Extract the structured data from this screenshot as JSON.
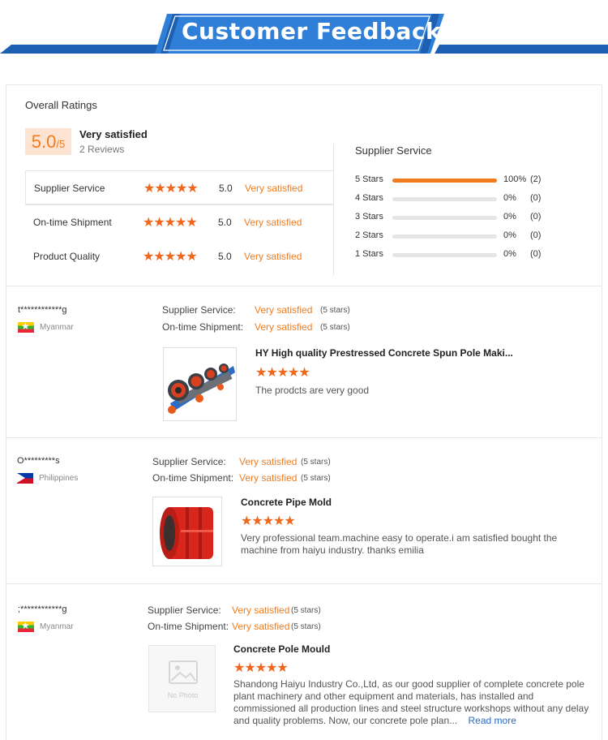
{
  "banner": {
    "title": "Customer Feedback",
    "color_dark": "#1d5fb0",
    "color_light": "#2f7ed8"
  },
  "overall": {
    "title": "Overall Ratings",
    "score": "5.0",
    "score_suffix": "/5",
    "label": "Very satisfied",
    "reviews": "2 Reviews",
    "categories": [
      {
        "name": "Supplier Service",
        "stars": "★★★★★",
        "score": "5.0",
        "text": "Very satisfied"
      },
      {
        "name": "On-time Shipment",
        "stars": "★★★★★",
        "score": "5.0",
        "text": "Very satisfied"
      },
      {
        "name": "Product Quality",
        "stars": "★★★★★",
        "score": "5.0",
        "text": "Very satisfied"
      }
    ]
  },
  "supplier_service": {
    "title": "Supplier Service",
    "rows": [
      {
        "label": "5  Stars",
        "fraction": 1.0,
        "pct": "100%",
        "count": "(2)"
      },
      {
        "label": "4  Stars",
        "fraction": 0,
        "pct": "0%",
        "count": "(0)"
      },
      {
        "label": "3  Stars",
        "fraction": 0,
        "pct": "0%",
        "count": "(0)"
      },
      {
        "label": "2  Stars",
        "fraction": 0,
        "pct": "0%",
        "count": "(0)"
      },
      {
        "label": "1  Stars",
        "fraction": 0,
        "pct": "0%",
        "count": "(0)"
      }
    ]
  },
  "reviews": [
    {
      "user": "t************g",
      "country": "Myanmar",
      "supplier_label": "Supplier Service:",
      "supplier_value": "Very satisfied",
      "supplier_stars": "(5 stars)",
      "shipment_label": "On-time Shipment:",
      "shipment_value": "Very satisfied",
      "shipment_stars": "(5 stars)",
      "product": "HY High quality Prestressed Concrete Spun Pole Maki...",
      "stars": "★★★★★",
      "comment": "The prodcts are very good"
    },
    {
      "user": "O*********s",
      "country": "Philippines",
      "supplier_label": "Supplier Service:",
      "supplier_value": "Very satisfied",
      "supplier_stars": "(5 stars)",
      "shipment_label": "On-time Shipment:",
      "shipment_value": "Very satisfied",
      "shipment_stars": "(5 stars)",
      "product": "Concrete Pipe Mold",
      "stars": "★★★★★",
      "comment": "Very professional team.machine easy to operate.i am satisfied bought the machine from haiyu industry. thanks emilia"
    },
    {
      "user": ";************g",
      "country": "Myanmar",
      "supplier_label": "Supplier Service:",
      "supplier_value": "Very satisfied",
      "supplier_stars": "(5 stars)",
      "shipment_label": "On-time Shipment:",
      "shipment_value": "Very satisfied",
      "shipment_stars": "(5 stars)",
      "product": "Concrete Pole Mould",
      "stars": "★★★★★",
      "comment": "Shandong Haiyu Industry Co.,Ltd, as our good supplier of complete concrete pole plant machinery and other equipment and materials, has installed and commissioned all production lines and steel structure workshops without any delay and quality problems. Now, our concrete pole plan...",
      "read_more": "Read more",
      "no_photo": "No Photo"
    }
  ]
}
